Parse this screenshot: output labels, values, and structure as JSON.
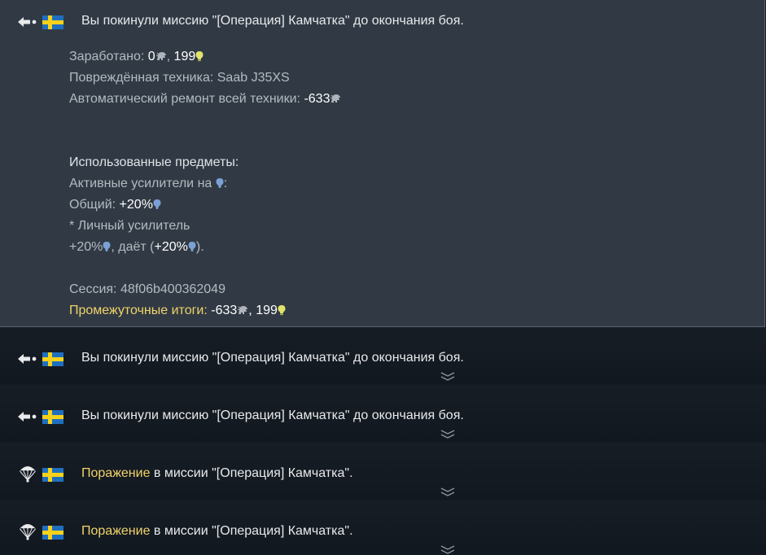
{
  "entries": [
    {
      "kind": "left",
      "text": "Вы покинули миссию \"[Операция] Камчатка\" до окончания боя.",
      "expanded": true,
      "details": {
        "earned_label": "Заработано: ",
        "earned_silver": "0",
        "earned_rp": "199",
        "damaged_label": "Повреждённая техника: ",
        "damaged_value": "Saab J35XS",
        "repair_label": "Автоматический ремонт всей техники: ",
        "repair_value": "-633",
        "used_items": "Использованные предметы:",
        "active_boosters": "Активные усилители на ",
        "general_label": "Общий: ",
        "general_value": "+20%",
        "personal_label": "* Личный усилитель",
        "personal_value": "+20%",
        "gives_label": ", даёт (",
        "gives_value": "+20%",
        "session_label": "Сессия: ",
        "session_value": "48f06b400362049",
        "subtotal_label": "Промежуточные итоги: ",
        "subtotal_silver": "-633",
        "subtotal_rp": "199"
      }
    },
    {
      "kind": "left",
      "text": "Вы покинули миссию \"[Операция] Камчатка\" до окончания боя."
    },
    {
      "kind": "left",
      "text": "Вы покинули миссию \"[Операция] Камчатка\" до окончания боя."
    },
    {
      "kind": "defeat",
      "highlight": "Поражение",
      "text": " в миссии \"[Операция] Камчатка\"."
    },
    {
      "kind": "defeat",
      "highlight": "Поражение",
      "text": " в миссии \"[Операция] Камчатка\"."
    }
  ],
  "icons": {
    "left_mission": "exit-arrow-icon",
    "defeat": "parachute-icon",
    "nation": "sweden-flag-icon",
    "silver": "silver-lion-icon",
    "research": "research-points-icon",
    "expand": "chevron-down-icon"
  },
  "colors": {
    "highlight": "#f0d36a",
    "rp_yellow": "#e2e36a",
    "rp_blue": "#7aa0d6",
    "panel": "#313a44",
    "background": "#141a21"
  }
}
